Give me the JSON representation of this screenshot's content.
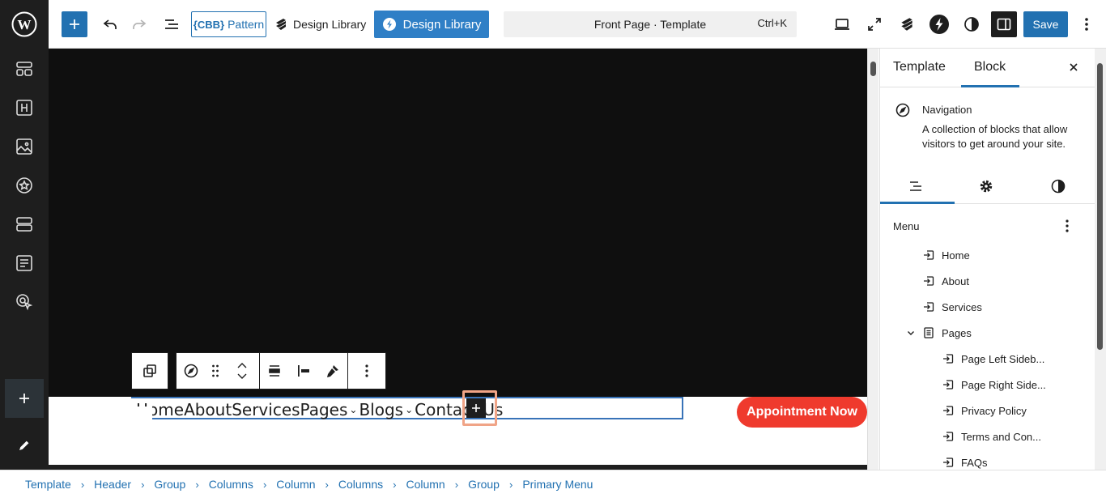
{
  "toolbar": {
    "pattern_logo": "{CBB}",
    "pattern_label": "Pattern",
    "design_library_plain": "Design Library",
    "design_library_button": "Design Library",
    "command_title": "Front Page · Template",
    "command_shortcut": "Ctrl+K",
    "save_label": "Save"
  },
  "canvas": {
    "nav_items": [
      {
        "label": "Home",
        "has_submenu": false
      },
      {
        "label": "About",
        "has_submenu": false
      },
      {
        "label": "Services",
        "has_submenu": false
      },
      {
        "label": "Pages",
        "has_submenu": true
      },
      {
        "label": "Blogs",
        "has_submenu": true
      },
      {
        "label": "Contact Us",
        "has_submenu": false
      }
    ],
    "cta_label": "Appointment Now"
  },
  "panel": {
    "tabs": [
      "Template",
      "Block"
    ],
    "active_tab": "Block",
    "block_title": "Navigation",
    "block_description": "A collection of blocks that allow visitors to get around your site.",
    "menu_label": "Menu",
    "menu_items": [
      {
        "label": "Home",
        "level": 0,
        "type": "link"
      },
      {
        "label": "About",
        "level": 0,
        "type": "link"
      },
      {
        "label": "Services",
        "level": 0,
        "type": "link"
      },
      {
        "label": "Pages",
        "level": 0,
        "type": "submenu"
      },
      {
        "label": "Page Left Sideb...",
        "level": 1,
        "type": "link"
      },
      {
        "label": "Page Right Side...",
        "level": 1,
        "type": "link"
      },
      {
        "label": "Privacy Policy",
        "level": 1,
        "type": "link"
      },
      {
        "label": "Terms and Con...",
        "level": 1,
        "type": "link"
      },
      {
        "label": "FAQs",
        "level": 1,
        "type": "link"
      }
    ]
  },
  "breadcrumb": [
    "Template",
    "Header",
    "Group",
    "Columns",
    "Column",
    "Columns",
    "Column",
    "Group",
    "Primary Menu"
  ],
  "colors": {
    "accent": "#2271b1",
    "cta": "#ef3a2d",
    "admin_bar": "#1e1e1e",
    "hero": "#0f0f0f"
  }
}
